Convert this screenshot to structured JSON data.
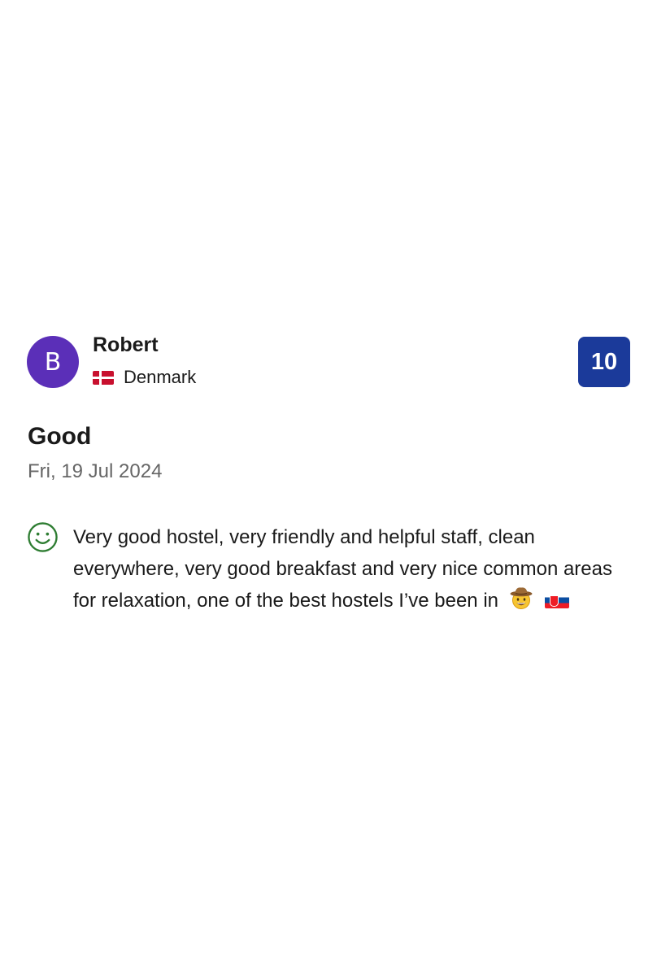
{
  "reviewer": {
    "avatar_initial": "B",
    "name": "Robert",
    "country": "Denmark"
  },
  "score": "10",
  "review": {
    "title": "Good",
    "date": "Fri, 19 Jul 2024",
    "text": "Very good hostel, very friendly and helpful staff, clean everywhere, very good breakfast and very nice common areas for relaxation, one of the best hostels I’ve been in"
  },
  "colors": {
    "avatar_bg": "#5b2fb8",
    "score_bg": "#1b3a9a",
    "positive_icon": "#2e7d32",
    "date_text": "#666666"
  },
  "icons": {
    "positive": "smiley-icon",
    "trailing_emoji": "cowboy-hat-face-icon",
    "trailing_flag": "slovakia-flag-icon",
    "country_flag": "denmark-flag-icon"
  }
}
